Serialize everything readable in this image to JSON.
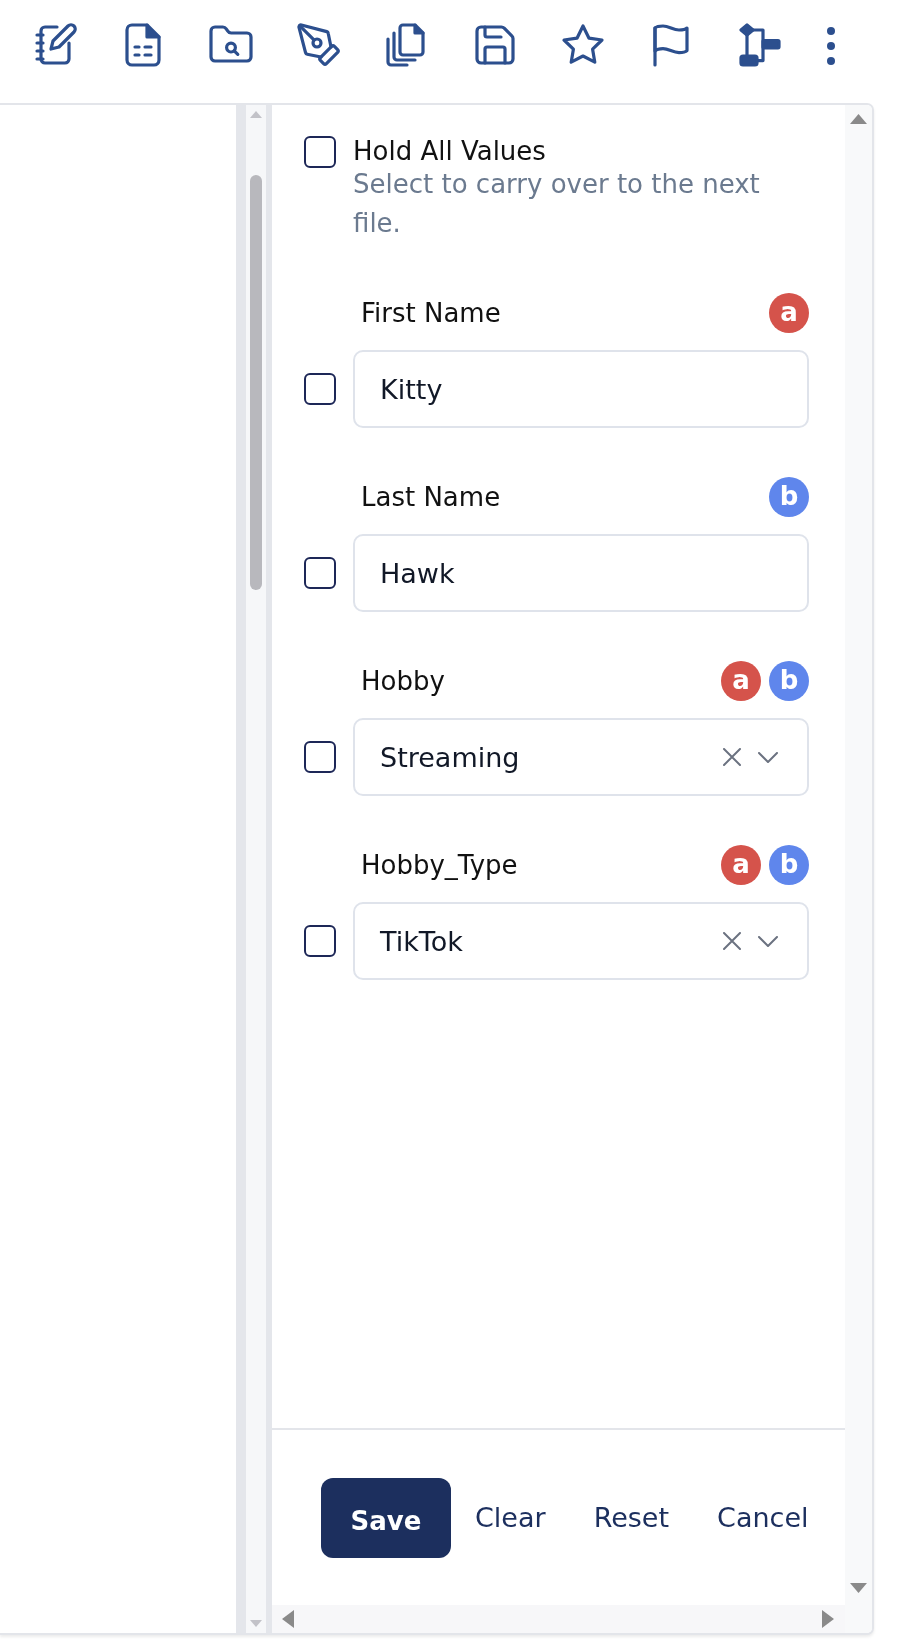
{
  "hold_all": {
    "label": "Hold All Values",
    "description": "Select to carry over to the next file.",
    "checked": false
  },
  "fields": [
    {
      "kind": "text",
      "label": "First Name",
      "value": "Kitty",
      "checked": false,
      "badges": [
        {
          "text": "a",
          "color": "#d5534b"
        }
      ]
    },
    {
      "kind": "text",
      "label": "Last Name",
      "value": "Hawk",
      "checked": false,
      "badges": [
        {
          "text": "b",
          "color": "#5f86ec"
        }
      ]
    },
    {
      "kind": "select",
      "label": "Hobby",
      "value": "Streaming",
      "checked": false,
      "badges": [
        {
          "text": "a",
          "color": "#d5534b"
        },
        {
          "text": "b",
          "color": "#5f86ec"
        }
      ]
    },
    {
      "kind": "select",
      "label": "Hobby_Type",
      "value": "TikTok",
      "checked": false,
      "badges": [
        {
          "text": "a",
          "color": "#d5534b"
        },
        {
          "text": "b",
          "color": "#5f86ec"
        }
      ]
    }
  ],
  "buttons": [
    {
      "label": "Save",
      "kind": "primary"
    },
    {
      "label": "Clear",
      "kind": "link"
    },
    {
      "label": "Reset",
      "kind": "link"
    },
    {
      "label": "Cancel",
      "kind": "link"
    }
  ]
}
